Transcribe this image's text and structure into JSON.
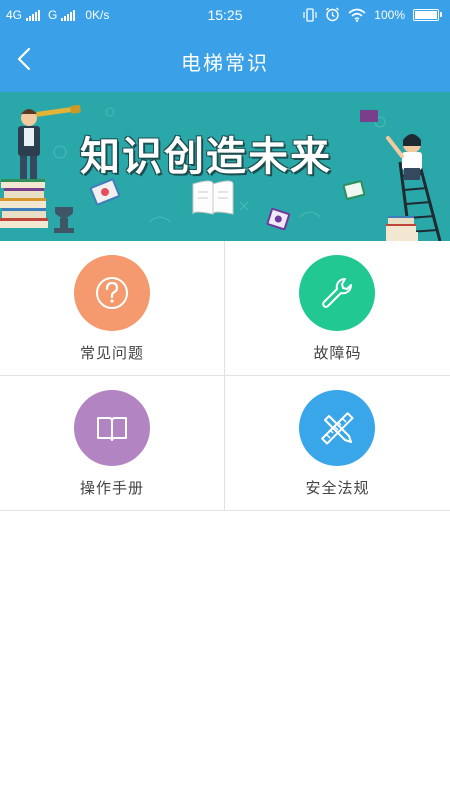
{
  "status_bar": {
    "network1": "4G",
    "network2": "G",
    "speed": "0K/s",
    "time": "15:25",
    "battery": "100%"
  },
  "header": {
    "title": "电梯常识"
  },
  "banner": {
    "text": "知识创造未来"
  },
  "grid": {
    "items": [
      {
        "label": "常见问题",
        "icon": "question-icon",
        "color": "#f49a6e"
      },
      {
        "label": "故障码",
        "icon": "wrench-icon",
        "color": "#21c891"
      },
      {
        "label": "操作手册",
        "icon": "book-icon",
        "color": "#b384c2"
      },
      {
        "label": "安全法规",
        "icon": "ruler-pencil-icon",
        "color": "#3aa6ea"
      }
    ]
  },
  "colors": {
    "primary": "#3aa0e8",
    "banner_bg": "#2aa7a8"
  }
}
